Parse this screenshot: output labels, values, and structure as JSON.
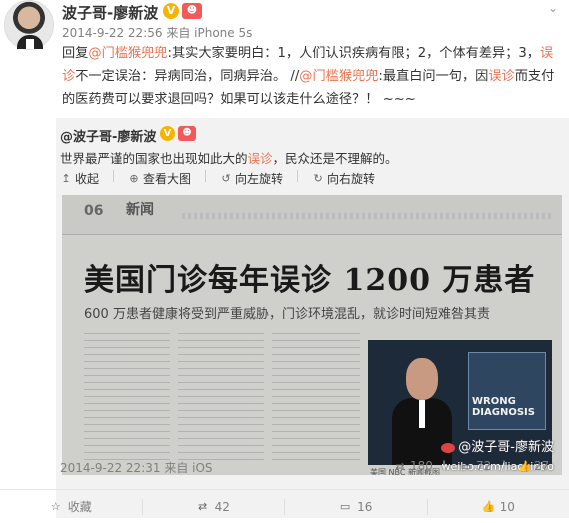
{
  "post": {
    "author": "波子哥-廖新波",
    "verified_glyph": "V",
    "badge_glyph": "☻",
    "time": "2014-9-22 22:56",
    "source": "来自 iPhone 5s",
    "text_parts": [
      {
        "t": "回复",
        "c": ""
      },
      {
        "t": "@门槛猴兜兜",
        "c": "mention"
      },
      {
        "t": ":其实大家要明白：1，人们认识疾病有限；2，个体有差异；3，",
        "c": ""
      },
      {
        "t": "误诊",
        "c": "link"
      },
      {
        "t": "不一定误治：异病同治，同病异治。 //",
        "c": ""
      },
      {
        "t": "@门槛猴兜兜",
        "c": "mention"
      },
      {
        "t": ":最直白问一句，因",
        "c": ""
      },
      {
        "t": "误诊",
        "c": "link"
      },
      {
        "t": "而支付的医药费可以要求退回吗？如果可以该走什么途径？！ ~~~",
        "c": ""
      }
    ]
  },
  "repost": {
    "author": "@波子哥-廖新波",
    "text_before": "世界最严谨的国家也出现如此大的",
    "text_highlight": "误诊",
    "text_after": "，民众还是不理解的。",
    "toolbar": {
      "collapse": "收起",
      "view_large": "查看大图",
      "rotate_left": "向左旋转",
      "rotate_right": "向右旋转"
    },
    "image": {
      "page_num": "06",
      "section": "新闻",
      "headline": "美国门诊每年误诊 1200 万患者",
      "subhead": "600 万患者健康将受到严重威胁，门诊环境混乱，就诊时间短难咎其责",
      "tv_text1": "WRONG",
      "tv_text2": "DIAGNOSIS",
      "caption": "美国 NBC 新闻截图",
      "watermark": "@波子哥-廖新波",
      "watermark_url": "weibo.com/liaoxinbo"
    },
    "time": "2014-9-22 22:31",
    "source": "来自 iOS",
    "reposts": "180",
    "comments": "72",
    "likes": "27"
  },
  "actions": {
    "favorite": "收藏",
    "repost": "42",
    "comment": "16",
    "like": "10"
  },
  "colors": {
    "accent": "#eb7350",
    "muted": "#808080",
    "repost_bg": "#f2f2f2"
  }
}
